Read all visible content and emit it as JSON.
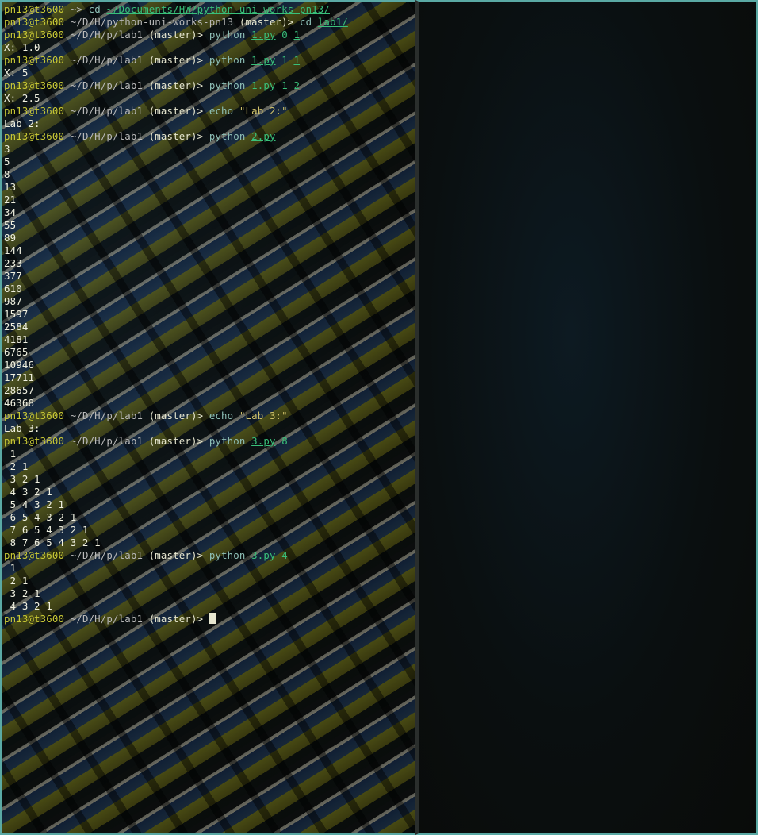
{
  "terminal": {
    "lines": [
      {
        "type": "prompt",
        "user": "pn13@t3600",
        "path": "~>",
        "branch": "",
        "cmd": "cd",
        "args": [
          {
            "text": "~/Documents/HW/python-uni-works-pn13/",
            "link": true
          }
        ]
      },
      {
        "type": "prompt",
        "user": "pn13@t3600",
        "path": "~/D/H/python-uni-works-pn13",
        "branch": "(master)>",
        "cmd": "cd",
        "args": [
          {
            "text": "lab1/",
            "link": true
          }
        ]
      },
      {
        "type": "prompt",
        "user": "pn13@t3600",
        "path": "~/D/H/p/lab1",
        "branch": "(master)>",
        "cmd": "python",
        "args": [
          {
            "text": "1.py",
            "link": true
          },
          {
            "text": "0",
            "link": false
          },
          {
            "text": "1",
            "link": true
          }
        ]
      },
      {
        "type": "output",
        "text": "X: 1.0"
      },
      {
        "type": "prompt",
        "user": "pn13@t3600",
        "path": "~/D/H/p/lab1",
        "branch": "(master)>",
        "cmd": "python",
        "args": [
          {
            "text": "1.py",
            "link": true
          },
          {
            "text": "1",
            "link": false
          },
          {
            "text": "1",
            "link": true
          }
        ]
      },
      {
        "type": "output",
        "text": "X: 5"
      },
      {
        "type": "prompt",
        "user": "pn13@t3600",
        "path": "~/D/H/p/lab1",
        "branch": "(master)>",
        "cmd": "python",
        "args": [
          {
            "text": "1.py",
            "link": true
          },
          {
            "text": "1",
            "link": false
          },
          {
            "text": "2",
            "link": true
          }
        ]
      },
      {
        "type": "output",
        "text": "X: 2.5"
      },
      {
        "type": "prompt",
        "user": "pn13@t3600",
        "path": "~/D/H/p/lab1",
        "branch": "(master)>",
        "cmd": "echo",
        "args": [
          {
            "text": "\"Lab 2:\"",
            "str": true
          }
        ]
      },
      {
        "type": "output",
        "text": "Lab 2:"
      },
      {
        "type": "prompt",
        "user": "pn13@t3600",
        "path": "~/D/H/p/lab1",
        "branch": "(master)>",
        "cmd": "python",
        "args": [
          {
            "text": "2.py",
            "link": true
          }
        ]
      },
      {
        "type": "output",
        "text": "3"
      },
      {
        "type": "output",
        "text": "5"
      },
      {
        "type": "output",
        "text": "8"
      },
      {
        "type": "output",
        "text": "13"
      },
      {
        "type": "output",
        "text": "21"
      },
      {
        "type": "output",
        "text": "34"
      },
      {
        "type": "output",
        "text": "55"
      },
      {
        "type": "output",
        "text": "89"
      },
      {
        "type": "output",
        "text": "144"
      },
      {
        "type": "output",
        "text": "233"
      },
      {
        "type": "output",
        "text": "377"
      },
      {
        "type": "output",
        "text": "610"
      },
      {
        "type": "output",
        "text": "987"
      },
      {
        "type": "output",
        "text": "1597"
      },
      {
        "type": "output",
        "text": "2584"
      },
      {
        "type": "output",
        "text": "4181"
      },
      {
        "type": "output",
        "text": "6765"
      },
      {
        "type": "output",
        "text": "10946"
      },
      {
        "type": "output",
        "text": "17711"
      },
      {
        "type": "output",
        "text": "28657"
      },
      {
        "type": "output",
        "text": "46368"
      },
      {
        "type": "prompt",
        "user": "pn13@t3600",
        "path": "~/D/H/p/lab1",
        "branch": "(master)>",
        "cmd": "echo",
        "args": [
          {
            "text": "\"Lab 3:\"",
            "str": true
          }
        ]
      },
      {
        "type": "output",
        "text": "Lab 3:"
      },
      {
        "type": "prompt",
        "user": "pn13@t3600",
        "path": "~/D/H/p/lab1",
        "branch": "(master)>",
        "cmd": "python",
        "args": [
          {
            "text": "3.py",
            "link": true
          },
          {
            "text": "8",
            "link": false
          }
        ]
      },
      {
        "type": "output",
        "text": " 1"
      },
      {
        "type": "output",
        "text": " 2 1"
      },
      {
        "type": "output",
        "text": " 3 2 1"
      },
      {
        "type": "output",
        "text": " 4 3 2 1"
      },
      {
        "type": "output",
        "text": " 5 4 3 2 1"
      },
      {
        "type": "output",
        "text": " 6 5 4 3 2 1"
      },
      {
        "type": "output",
        "text": " 7 6 5 4 3 2 1"
      },
      {
        "type": "output",
        "text": " 8 7 6 5 4 3 2 1"
      },
      {
        "type": "prompt",
        "user": "pn13@t3600",
        "path": "~/D/H/p/lab1",
        "branch": "(master)>",
        "cmd": "python",
        "args": [
          {
            "text": "3.py",
            "link": true
          },
          {
            "text": "4",
            "link": false
          }
        ]
      },
      {
        "type": "output",
        "text": " 1"
      },
      {
        "type": "output",
        "text": " 2 1"
      },
      {
        "type": "output",
        "text": " 3 2 1"
      },
      {
        "type": "output",
        "text": " 4 3 2 1"
      },
      {
        "type": "current",
        "user": "pn13@t3600",
        "path": "~/D/H/p/lab1",
        "branch": "(master)>"
      }
    ]
  }
}
